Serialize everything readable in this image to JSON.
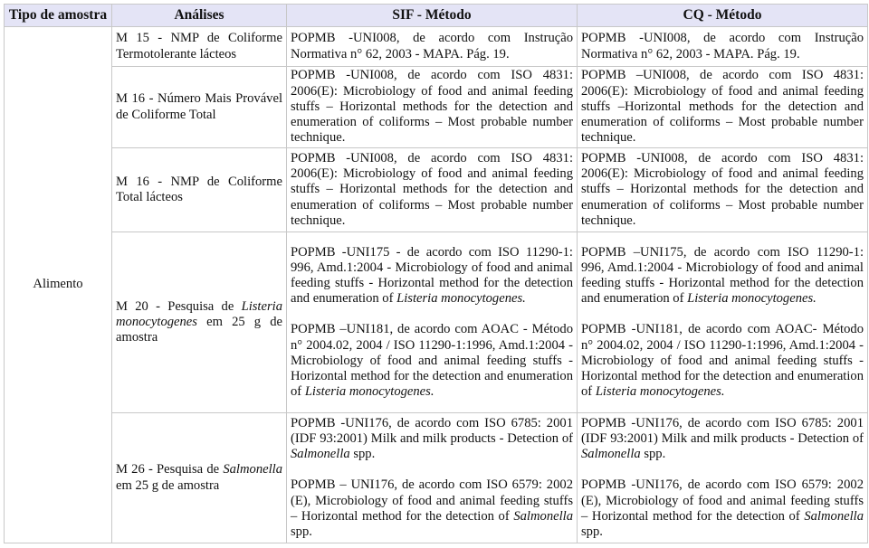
{
  "table": {
    "headers": [
      "Tipo de amostra",
      "Análises",
      "SIF - Método",
      "CQ - Método"
    ],
    "sample_type": "Alimento",
    "rows": [
      {
        "analysis": [
          {
            "text": "M 15 - NMP de Coliforme Termotolerante lácteos",
            "italic": false
          }
        ],
        "sif": [
          [
            {
              "text": "POPMB -UNI008, de acordo com Instrução Normativa n° 62, 2003 - MAPA. Pág. 19.",
              "italic": false
            }
          ]
        ],
        "cq": [
          [
            {
              "text": "POPMB -UNI008, de acordo com Instrução Normativa n° 62, 2003 - MAPA. Pág. 19.",
              "italic": false
            }
          ]
        ]
      },
      {
        "analysis": [
          {
            "text": "M 16 - Número Mais Provável de Coliforme Total",
            "italic": false
          }
        ],
        "sif": [
          [
            {
              "text": "POPMB -UNI008, de acordo com ISO 4831: 2006(E): Microbiology of food and animal feeding stuffs – Horizontal methods for the detection and enumeration of coliforms – Most probable number technique.",
              "italic": false
            }
          ]
        ],
        "cq": [
          [
            {
              "text": "POPMB –UNI008, de acordo com ISO 4831: 2006(E): Microbiology of food and animal feeding stuffs –Horizontal methods for the detection and enumeration of coliforms – Most probable number technique.",
              "italic": false
            }
          ]
        ]
      },
      {
        "analysis": [
          {
            "text": "M 16 - NMP de Coliforme Total lácteos",
            "italic": false
          }
        ],
        "sif": [
          [
            {
              "text": "POPMB -UNI008, de acordo com ISO 4831: 2006(E): Microbiology of food and animal feeding stuffs – Horizontal methods for the detection and enumeration of coliforms – Most probable number technique.",
              "italic": false
            }
          ]
        ],
        "cq": [
          [
            {
              "text": "POPMB -UNI008, de acordo com ISO 4831: 2006(E): Microbiology of food and animal feeding stuffs – Horizontal methods for the detection and enumeration of coliforms – Most probable number technique.",
              "italic": false
            }
          ]
        ]
      },
      {
        "analysis": [
          {
            "text": "M 20 - Pesquisa de ",
            "italic": false
          },
          {
            "text": "Listeria monocytogenes",
            "italic": true
          },
          {
            "text": " em 25 g de amostra",
            "italic": false
          }
        ],
        "sif": [
          [
            {
              "text": "POPMB -UNI175 - de acordo com ISO 11290-1: 996, Amd.1:2004 - Microbiology of food and animal feeding stuffs - Horizontal method for the detection and enumeration of ",
              "italic": false
            },
            {
              "text": "Listeria monocytogenes.",
              "italic": true
            }
          ],
          [
            {
              "text": "POPMB –UNI181, de acordo com AOAC - Método n° 2004.02, 2004 / ISO 11290-1:1996, Amd.1:2004 - Microbiology of food and animal feeding stuffs - Horizontal method for the detection and enumeration of ",
              "italic": false
            },
            {
              "text": "Listeria monocytogenes.",
              "italic": true
            }
          ]
        ],
        "cq": [
          [
            {
              "text": "POPMB –UNI175, de acordo com ISO 11290-1: 996, Amd.1:2004 - Microbiology of food and animal feeding stuffs - Horizontal method for the detection and enumeration of ",
              "italic": false
            },
            {
              "text": "Listeria monocytogenes.",
              "italic": true
            }
          ],
          [
            {
              "text": "POPMB -UNI181, de acordo com AOAC- Método n° 2004.02, 2004 / ISO 11290-1:1996, Amd.1:2004 - Microbiology of food and animal feeding stuffs - Horizontal method for the detection and enumeration of ",
              "italic": false
            },
            {
              "text": "Listeria monocytogenes.",
              "italic": true
            }
          ]
        ]
      },
      {
        "analysis": [
          {
            "text": "M 26 - Pesquisa de ",
            "italic": false
          },
          {
            "text": "Salmonella",
            "italic": true
          },
          {
            "text": " em 25 g de amostra",
            "italic": false
          }
        ],
        "sif": [
          [
            {
              "text": "POPMB -UNI176, de acordo com ISO 6785: 2001 (IDF 93:2001) Milk and milk products - Detection of ",
              "italic": false
            },
            {
              "text": "Salmonella",
              "italic": true
            },
            {
              "text": " spp.",
              "italic": false
            }
          ],
          [
            {
              "text": "POPMB – UNI176, de acordo com ISO 6579: 2002 (E), Microbiology of food and animal feeding stuffs – Horizontal method for the detection of ",
              "italic": false
            },
            {
              "text": "Salmonella",
              "italic": true
            },
            {
              "text": " spp.",
              "italic": false
            }
          ]
        ],
        "cq": [
          [
            {
              "text": "POPMB -UNI176, de acordo com ISO 6785: 2001 (IDF 93:2001) Milk and milk products - Detection of ",
              "italic": false
            },
            {
              "text": "Salmonella",
              "italic": true
            },
            {
              "text": " spp.",
              "italic": false
            }
          ],
          [
            {
              "text": "POPMB -UNI176, de acordo com ISO 6579: 2002 (E), Microbiology of food and animal feeding stuffs – Horizontal method for the detection of ",
              "italic": false
            },
            {
              "text": "Salmonella",
              "italic": true
            },
            {
              "text": " spp.",
              "italic": false
            }
          ]
        ]
      }
    ]
  }
}
